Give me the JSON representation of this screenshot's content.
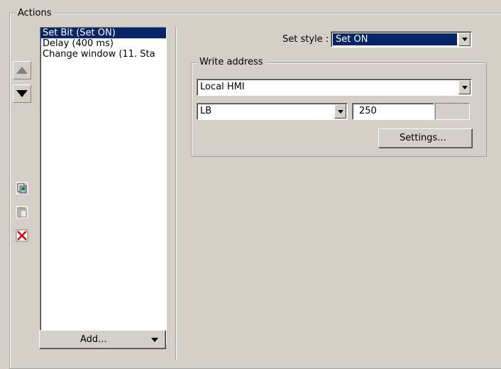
{
  "actions_group": {
    "title": "Actions",
    "list_items": [
      {
        "label": "Set Bit (Set ON)",
        "selected": true
      },
      {
        "label": "Delay (400 ms)",
        "selected": false
      },
      {
        "label": "Change window (11. Sta",
        "selected": false
      }
    ],
    "add_button_label": "Add..."
  },
  "set_style": {
    "label": "Set style :",
    "value": "Set ON"
  },
  "write_address": {
    "title": "Write address",
    "device": "Local HMI",
    "register": "LB",
    "address": "250",
    "settings_button_label": "Settings..."
  },
  "icons": [
    "move-up-icon",
    "move-down-icon",
    "copy-icon",
    "paste-icon",
    "delete-icon"
  ],
  "colors": {
    "selection_bg": "#0a246a",
    "delete_red": "#e00000",
    "window_bg": "#d4d0c8"
  }
}
